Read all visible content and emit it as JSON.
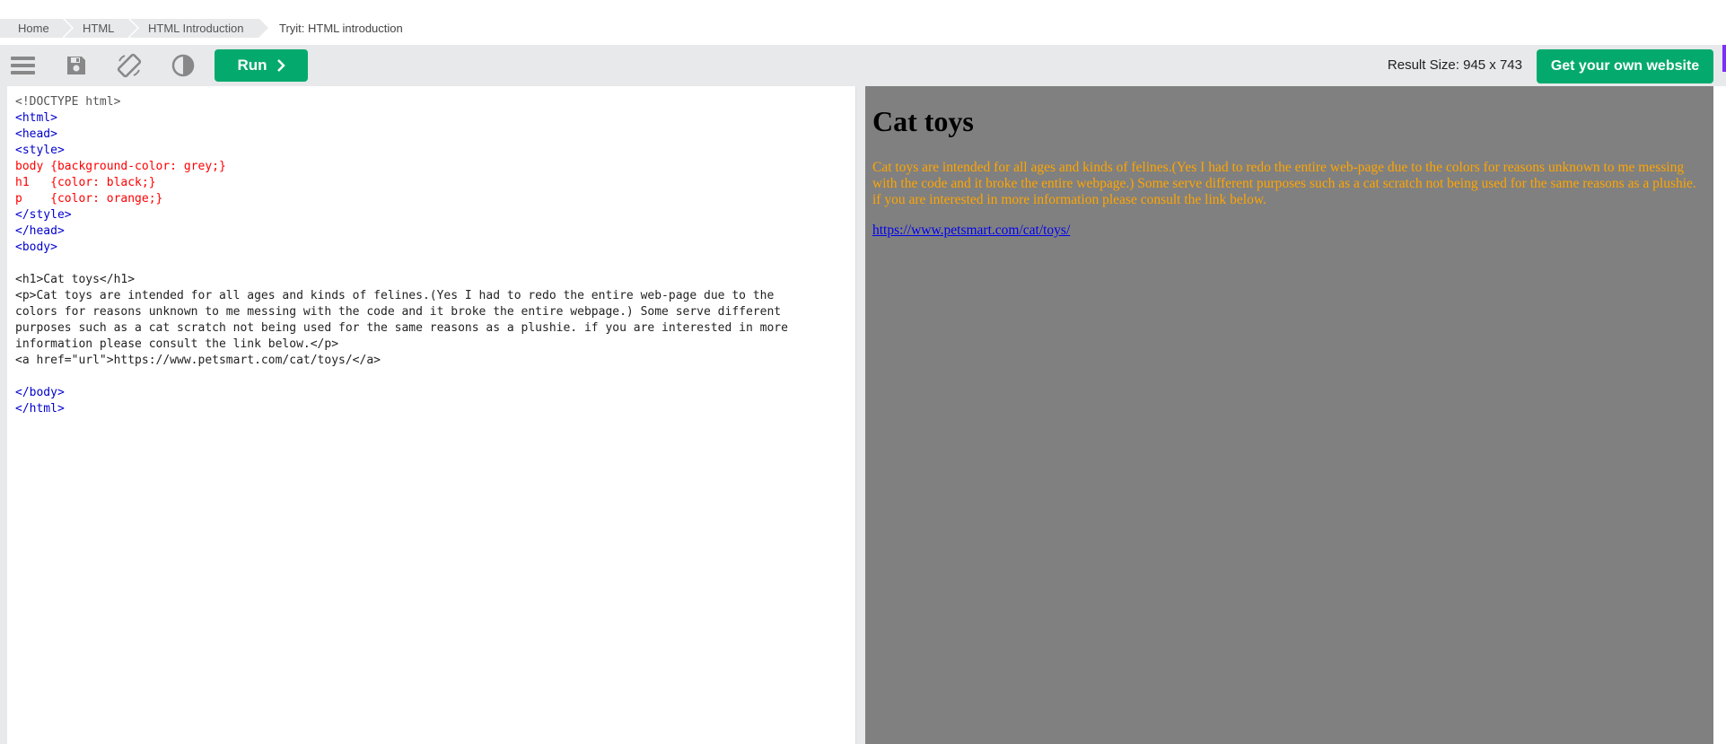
{
  "breadcrumb": {
    "items": [
      "Home",
      "HTML",
      "HTML Introduction",
      "Tryit: HTML introduction"
    ]
  },
  "toolbar": {
    "run_label": "Run",
    "result_size": "Result Size: 945 x 743",
    "get_website_label": "Get your own website",
    "icons": [
      "menu-icon",
      "save-icon",
      "rotate-icon",
      "contrast-icon",
      "chevron-right-icon"
    ]
  },
  "editor": {
    "lines": [
      "<!DOCTYPE html>",
      "<html>",
      "<head>",
      "<style>",
      "body {background-color: grey;}",
      "h1   {color: black;}",
      "p    {color: orange;}",
      "</style>",
      "</head>",
      "<body>",
      "",
      "<h1>Cat toys</h1>",
      "<p>Cat toys are intended for all ages and kinds of felines.(Yes I had to redo the entire web-page due to the",
      "colors for reasons unknown to me messing with the code and it broke the entire webpage.) Some serve different",
      "purposes such as a cat scratch not being used for the same reasons as a plushie. if you are interested in more",
      "information please consult the link below.</p>",
      "<a href=\"url\">https://www.petsmart.com/cat/toys/</a>",
      "",
      "</body>",
      "</html>"
    ]
  },
  "result": {
    "heading": "Cat toys",
    "paragraph": "Cat toys are intended for all ages and kinds of felines.(Yes I had to redo the entire web-page due to the colors for reasons unknown to me messing with the code and it broke the entire webpage.) Some serve different purposes such as a cat scratch not being used for the same reasons as a plushie. if you are interested in more information please consult the link below.",
    "link": "https://www.petsmart.com/cat/toys/",
    "background": "#808080",
    "heading_color": "#000000",
    "paragraph_color": "orange"
  },
  "colors": {
    "accent": "#04aa6d",
    "toolbar_bg": "#e7e9eb"
  }
}
